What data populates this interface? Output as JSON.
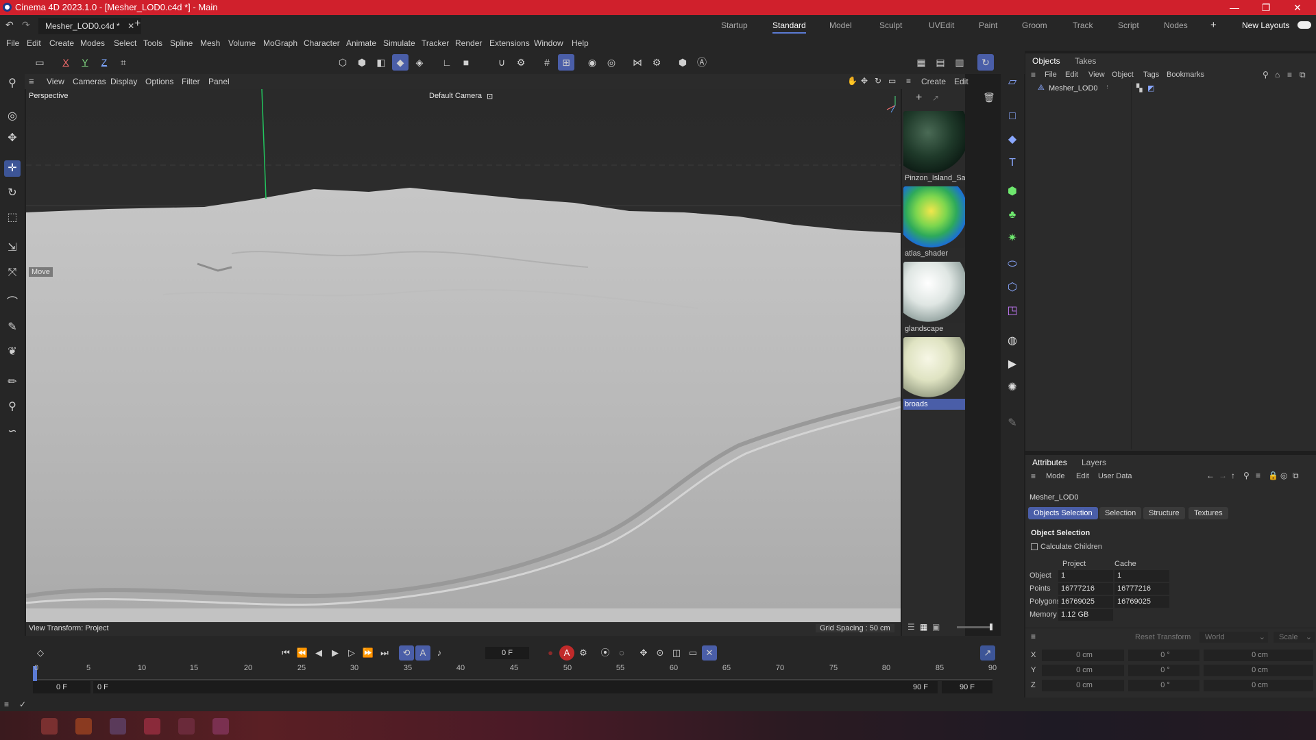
{
  "window": {
    "title": "Cinema 4D 2023.1.0 - [Mesher_LOD0.c4d *] - Main",
    "controls": [
      "—",
      "❐",
      "✕"
    ]
  },
  "tabs": {
    "document": "Mesher_LOD0.c4d *",
    "add": "+",
    "layouts": [
      "Startup",
      "Standard",
      "Model",
      "Sculpt",
      "UVEdit",
      "Paint",
      "Groom",
      "Track",
      "Script",
      "Nodes"
    ],
    "active_layout": "Standard",
    "new_layouts": "New Layouts"
  },
  "menu": [
    "File",
    "Edit",
    "Create",
    "Modes",
    "Select",
    "Tools",
    "Spline",
    "Mesh",
    "Volume",
    "MoGraph",
    "Character",
    "Animate",
    "Simulate",
    "Tracker",
    "Render",
    "Extensions",
    "Window",
    "Help"
  ],
  "toolbar": {
    "axes": [
      "X",
      "Y",
      "Z"
    ]
  },
  "viewport": {
    "menu": [
      "View",
      "Cameras",
      "Display",
      "Options",
      "Filter",
      "Panel"
    ],
    "projection": "Perspective",
    "camera": "Default Camera",
    "tool_label": "Move",
    "view_transform": "View Transform: Project",
    "grid_spacing": "Grid Spacing : 50 cm",
    "colors": {
      "ground": "#b8b8b8",
      "sky": "#2e2e2e",
      "y_axis": "#22c55e"
    }
  },
  "materials": {
    "menu": [
      "Create",
      "Edit"
    ],
    "items": [
      {
        "name": "Pinzon_Island_Sat",
        "icon": "material-sphere-dark-green"
      },
      {
        "name": "atlas_shader",
        "icon": "material-sphere-gradient"
      },
      {
        "name": "glandscape",
        "icon": "material-sphere-white-marble"
      },
      {
        "name": "broads",
        "icon": "material-sphere-cream"
      }
    ],
    "selected": "broads"
  },
  "objects": {
    "tabs": [
      "Objects",
      "Takes"
    ],
    "menu": [
      "File",
      "Edit",
      "View",
      "Object",
      "Tags",
      "Bookmarks"
    ],
    "tree": [
      {
        "name": "Mesher_LOD0"
      }
    ]
  },
  "attributes": {
    "tabs": [
      "Attributes",
      "Layers"
    ],
    "menu": [
      "Mode",
      "Edit",
      "User Data"
    ],
    "object_name": "Mesher_LOD0",
    "subtabs": [
      "Objects Selection",
      "Selection",
      "Structure",
      "Textures"
    ],
    "active_subtab": "Objects Selection",
    "section_title": "Object Selection",
    "calculate_children": "Calculate Children",
    "columns": [
      "Project",
      "Cache"
    ],
    "rows": [
      {
        "label": "Object",
        "project": "1",
        "cache": "1"
      },
      {
        "label": "Points",
        "project": "16777216",
        "cache": "16777216"
      },
      {
        "label": "Polygons",
        "project": "16769025",
        "cache": "16769025"
      },
      {
        "label": "Memory",
        "project": "1.12 GB",
        "cache": ""
      }
    ],
    "transform": {
      "reset": "Reset Transform",
      "space": "World",
      "mode": "Scale",
      "rows": [
        {
          "axis": "X",
          "pos": "0 cm",
          "rot": "0 °",
          "scale": "0 cm"
        },
        {
          "axis": "Y",
          "pos": "0 cm",
          "rot": "0 °",
          "scale": "0 cm"
        },
        {
          "axis": "Z",
          "pos": "0 cm",
          "rot": "0 °",
          "scale": "0 cm"
        }
      ]
    }
  },
  "timeline": {
    "current_frame": "0 F",
    "ticks": [
      "0",
      "5",
      "10",
      "15",
      "20",
      "25",
      "30",
      "35",
      "40",
      "45",
      "50",
      "55",
      "60",
      "65",
      "70",
      "75",
      "80",
      "85",
      "90"
    ],
    "start": "0 F",
    "start_preview": "0 F",
    "end_preview": "90 F",
    "end": "90 F"
  }
}
